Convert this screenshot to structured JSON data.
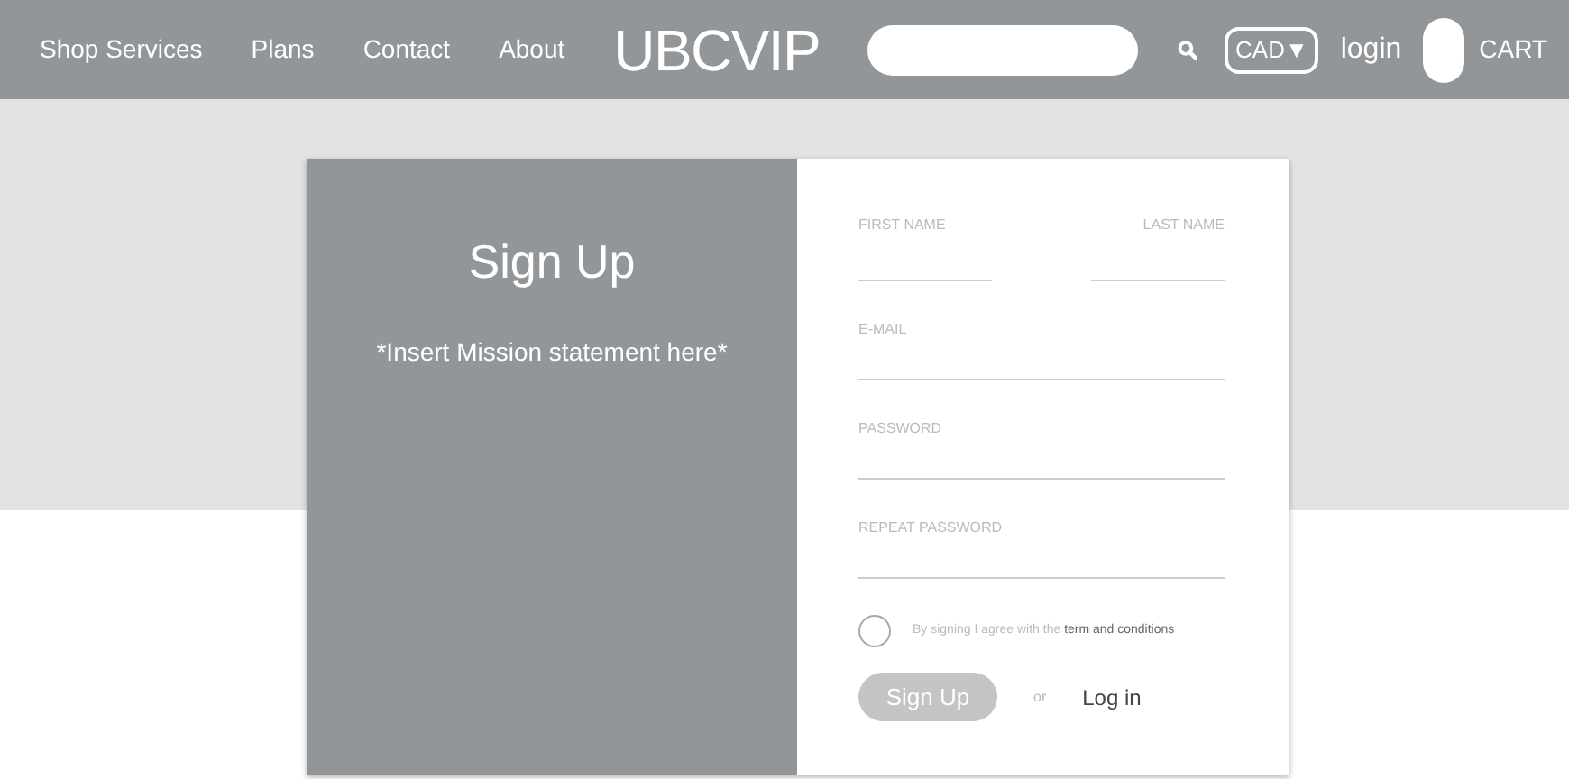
{
  "nav": {
    "links": [
      "Shop Services",
      "Plans",
      "Contact",
      "About"
    ],
    "logo": "**UBC**VIP",
    "currency": "CAD▼",
    "login": "login",
    "cart": "CART"
  },
  "signup": {
    "title": "Sign Up",
    "mission": "*Insert Mission statement here*",
    "fields": [
      {
        "placeholder": "FIRST NAME"
      },
      {
        "placeholder": "LAST NAME"
      },
      {
        "placeholder": "E-MAIL"
      },
      {
        "placeholder": "PASSWORD"
      },
      {
        "placeholder": "REPEAT PASSWORD"
      }
    ],
    "agree": {
      "checked": false,
      "text": "By signing I agree with the **term and conditions**"
    },
    "submit": "Sign Up",
    "or": "or",
    "login": "Log in"
  }
}
